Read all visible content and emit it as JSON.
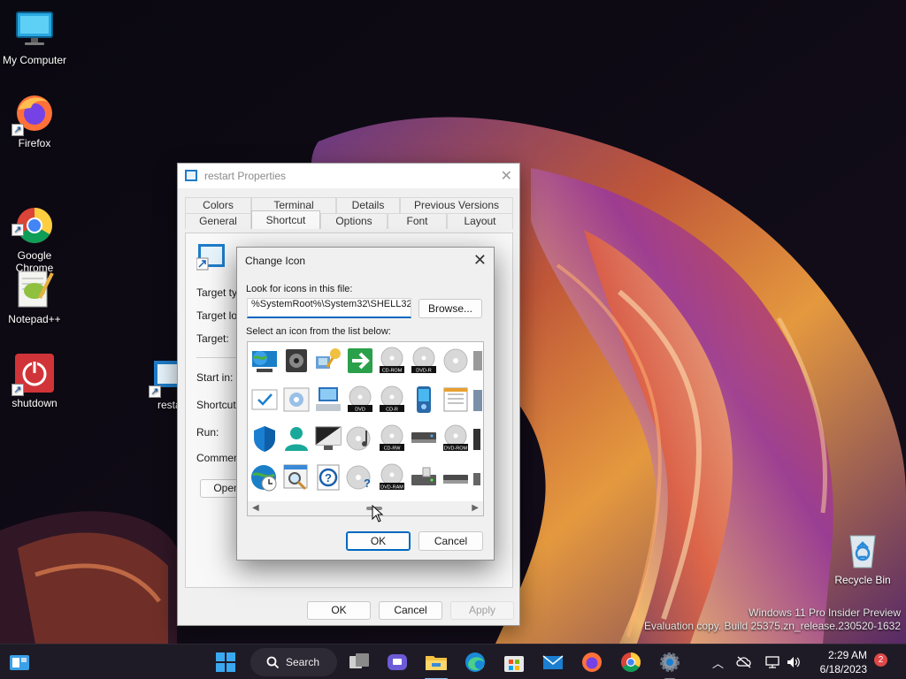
{
  "desktop": {
    "icons": [
      {
        "label": "My Computer"
      },
      {
        "label": "Firefox"
      },
      {
        "label": "Google\nChrome"
      },
      {
        "label": "Notepad++"
      },
      {
        "label": "shutdown"
      },
      {
        "label": "resta"
      },
      {
        "label": "Recycle Bin"
      }
    ],
    "watermark_line1": "Windows 11 Pro Insider Preview",
    "watermark_line2": "Evaluation copy. Build 25375.zn_release.230520-1632"
  },
  "properties": {
    "title": "restart Properties",
    "tabs_row1": [
      "Colors",
      "Terminal",
      "Details",
      "Previous Versions"
    ],
    "tabs_row2": [
      "General",
      "Shortcut",
      "Options",
      "Font",
      "Layout"
    ],
    "active_tab": "Shortcut",
    "fields": {
      "target_type": "Target typ",
      "target_location": "Target loc",
      "target": "Target:",
      "start_in": "Start in:",
      "shortcut_key": "Shortcut k",
      "run": "Run:",
      "comment": "Comment:"
    },
    "open_button": "Open",
    "ok": "OK",
    "cancel": "Cancel",
    "apply": "Apply"
  },
  "change_icon": {
    "title": "Change Icon",
    "look_label": "Look for icons in this file:",
    "path_value": "%SystemRoot%\\System32\\SHELL32",
    "browse": "Browse...",
    "select_label": "Select an icon from the list below:",
    "ok": "OK",
    "cancel": "Cancel",
    "disc_labels": [
      "CD-ROM",
      "DVD-R",
      "DVD",
      "CD-R",
      "CD-RW",
      "DVD-ROM",
      "DVD-RAM"
    ]
  },
  "taskbar": {
    "search_label": "Search",
    "time": "2:29 AM",
    "date": "6/18/2023",
    "notification_count": "2"
  },
  "colors": {
    "accent": "#0067c0",
    "taskbar": "#1f1b26",
    "shutdown_red": "#d13438"
  }
}
